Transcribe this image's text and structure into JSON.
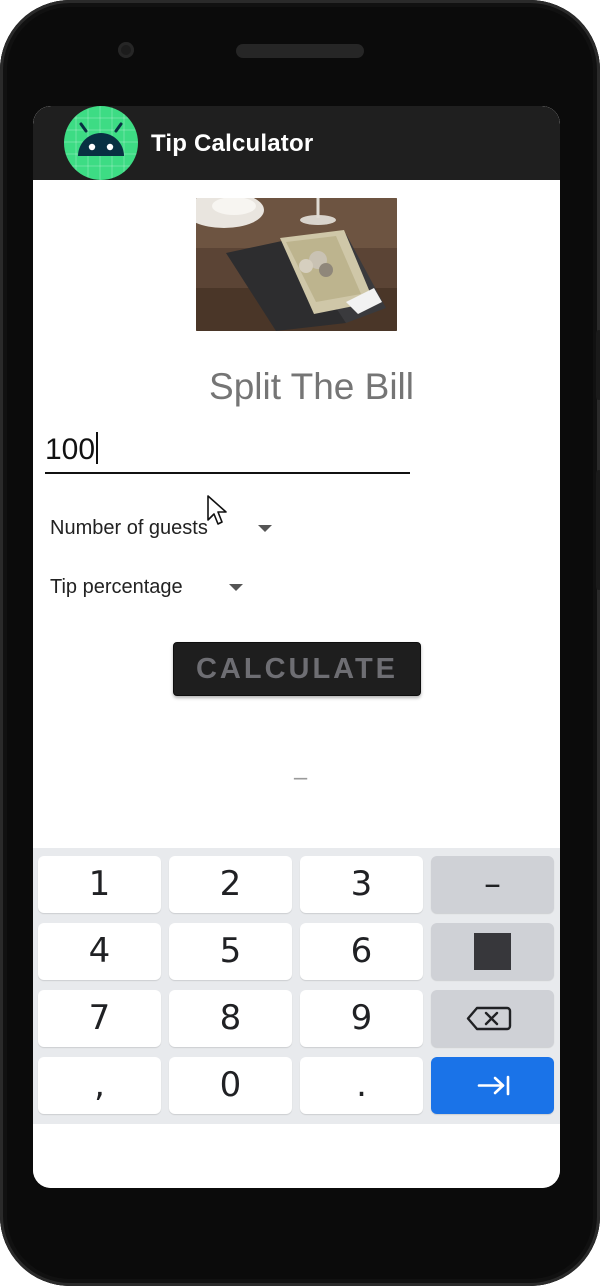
{
  "app": {
    "title": "Tip Calculator",
    "brand_color": "#3ddc84",
    "appbar_color": "#1f1f1f"
  },
  "main": {
    "heading": "Split The Bill",
    "bill_amount_value": "100",
    "guests_label": "Number of guests",
    "tip_label": "Tip percentage",
    "calculate_label": "CALCULATE",
    "result_text": "–"
  },
  "keyboard": {
    "rows": [
      [
        "1",
        "2",
        "3",
        "–"
      ],
      [
        "4",
        "5",
        "6",
        "stop-icon"
      ],
      [
        "7",
        "8",
        "9",
        "backspace-icon"
      ],
      [
        ",",
        "0",
        ".",
        "next-icon"
      ]
    ],
    "action_color": "#1a73e8"
  },
  "icons": [
    "android-logo-icon",
    "stop-icon",
    "backspace-icon",
    "next-icon",
    "chevron-down-icon",
    "mouse-cursor-icon"
  ]
}
